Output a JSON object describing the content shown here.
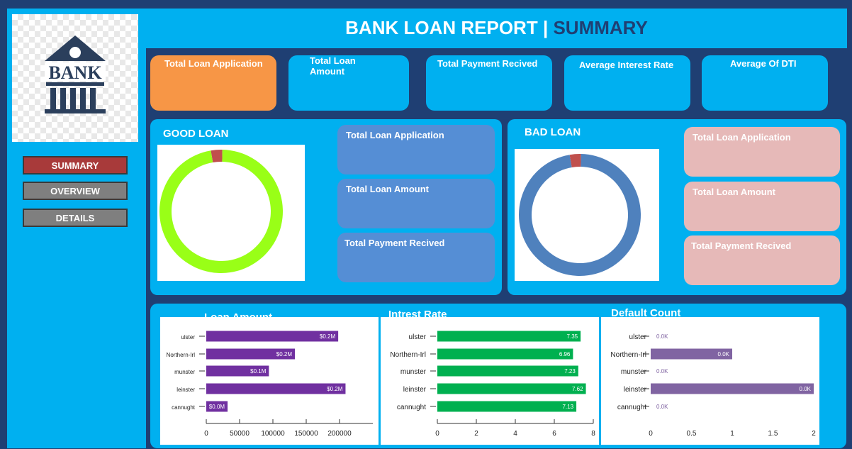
{
  "header": {
    "title_main": "BANK LOAN REPORT",
    "separator": " | ",
    "title_sub": "SUMMARY"
  },
  "logo": {
    "text": "BANK"
  },
  "nav": {
    "summary": {
      "label": "SUMMARY",
      "color": "#a83a3a"
    },
    "overview": {
      "label": "OVERVIEW",
      "color": "#7f7f7f"
    },
    "details": {
      "label": "DETAILS",
      "color": "#7f7f7f"
    }
  },
  "kpis": [
    {
      "label": "Total Loan Application"
    },
    {
      "label": "Total Loan Amount"
    },
    {
      "label": "Total Payment Recived"
    },
    {
      "label": "Average Interest Rate"
    },
    {
      "label": "Average Of DTI"
    }
  ],
  "good_loan": {
    "title": "GOOD LOAN",
    "cards": [
      "Total Loan Application",
      "Total Loan Amount",
      "Total Payment Recived"
    ],
    "donut_colors": [
      "#99ff17",
      "#c0504d"
    ]
  },
  "bad_loan": {
    "title": "BAD LOAN",
    "cards": [
      "Total Loan Application",
      "Total Loan Amount",
      "Total Payment Recived"
    ],
    "donut_colors": [
      "#4f81bd",
      "#c0504d"
    ]
  },
  "chart_data": [
    {
      "type": "pie",
      "title": "GOOD LOAN",
      "values": [
        97,
        3
      ],
      "colors": [
        "#99ff17",
        "#c0504d"
      ]
    },
    {
      "type": "pie",
      "title": "BAD LOAN",
      "values": [
        97,
        3
      ],
      "colors": [
        "#4f81bd",
        "#c0504d"
      ]
    },
    {
      "type": "bar",
      "title": "Loan Amount",
      "categories": [
        "ulster",
        "Northern-Irl",
        "munster",
        "leinster",
        "cannught"
      ],
      "values": [
        198000,
        133000,
        94000,
        209000,
        32000
      ],
      "labels": [
        "$0.2M",
        "$0.2M",
        "$0.1M",
        "$0.2M",
        "$0.0M"
      ],
      "xticks": [
        "0",
        "50000",
        "100000",
        "150000",
        "200000"
      ],
      "xlim": [
        0,
        250000
      ],
      "color": "#7030a0"
    },
    {
      "type": "bar",
      "title": "Intrest Rate",
      "categories": [
        "ulster",
        "Northern-Irl",
        "munster",
        "leinster",
        "cannught"
      ],
      "values": [
        7.35,
        6.96,
        7.23,
        7.62,
        7.13
      ],
      "labels": [
        "7.35",
        "6.96",
        "7.23",
        "7.62",
        "7.13"
      ],
      "xticks": [
        "0",
        "2",
        "4",
        "6",
        "8"
      ],
      "xlim": [
        0,
        8
      ],
      "color": "#00b050"
    },
    {
      "type": "bar",
      "title": "Default Count",
      "categories": [
        "ulster",
        "Northern-Irl",
        "munster",
        "leinster",
        "cannught"
      ],
      "values": [
        0,
        1,
        0,
        2,
        0
      ],
      "labels": [
        "0.0K",
        "0.0K",
        "0.0K",
        "0.0K",
        "0.0K"
      ],
      "xticks": [
        "0",
        "0.5",
        "1",
        "1.5",
        "2"
      ],
      "xlim": [
        0,
        2
      ],
      "color": "#8064a2"
    }
  ]
}
